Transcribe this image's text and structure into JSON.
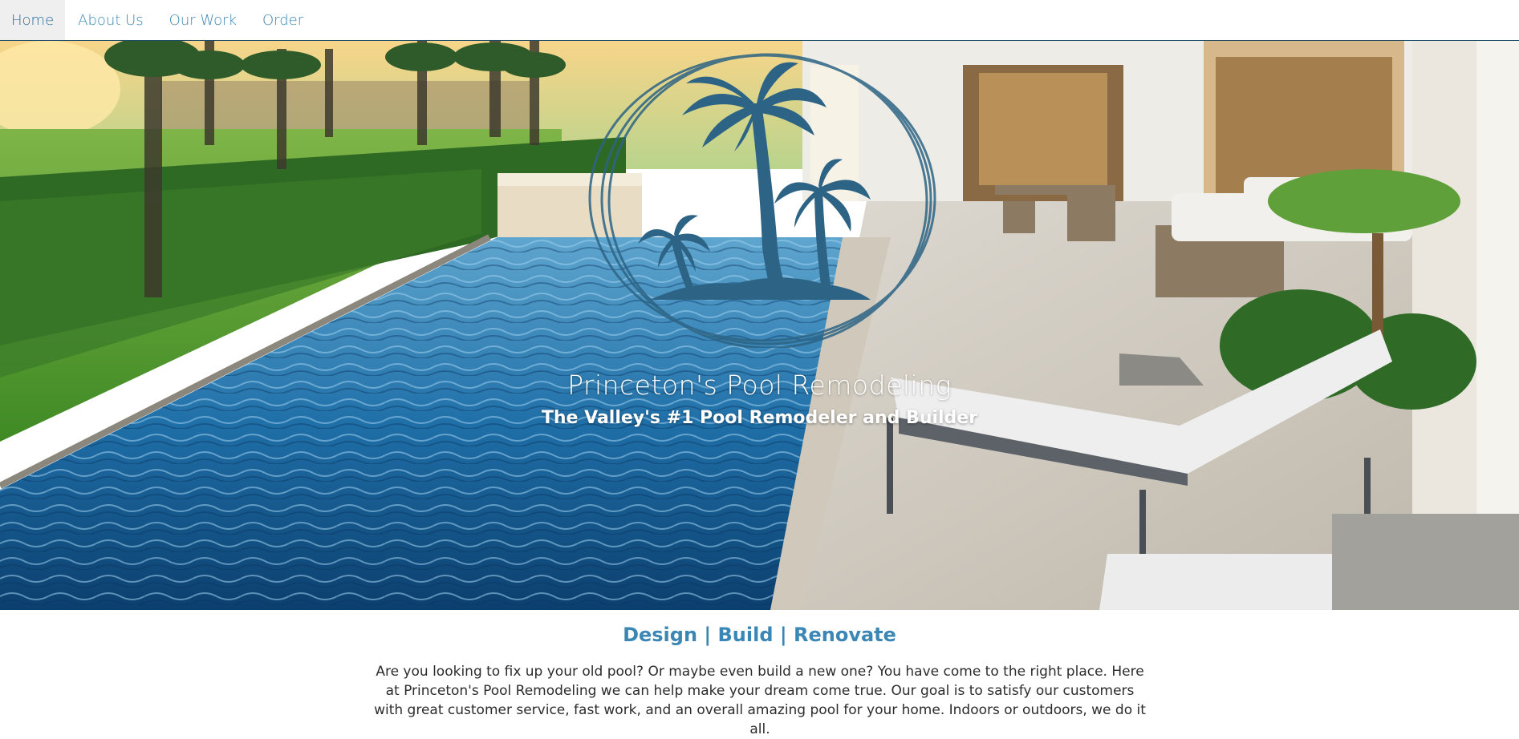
{
  "nav": {
    "items": [
      {
        "label": "Home",
        "active": true
      },
      {
        "label": "About Us",
        "active": false
      },
      {
        "label": "Our Work",
        "active": false
      },
      {
        "label": "Order",
        "active": false
      }
    ]
  },
  "hero": {
    "title": "Princeton's Pool Remodeling",
    "subtitle": "The Valley's #1 Pool Remodeler and Builder",
    "logo_icon": "palm-trees-logo-icon",
    "logo_color": "#2d6485"
  },
  "content": {
    "tagline": "Design | Build | Renovate",
    "intro": "Are you looking to fix up your old pool? Or maybe even build a new one? You have come to the right place. Here at Princeton's Pool Remodeling we can help make your dream come true. Our goal is to satisfy our customers with great customer service, fast work, and an overall amazing pool for your home. Indoors or outdoors, we do it all."
  },
  "colors": {
    "accent": "#3a87b5",
    "nav_border": "#1f4e66"
  }
}
